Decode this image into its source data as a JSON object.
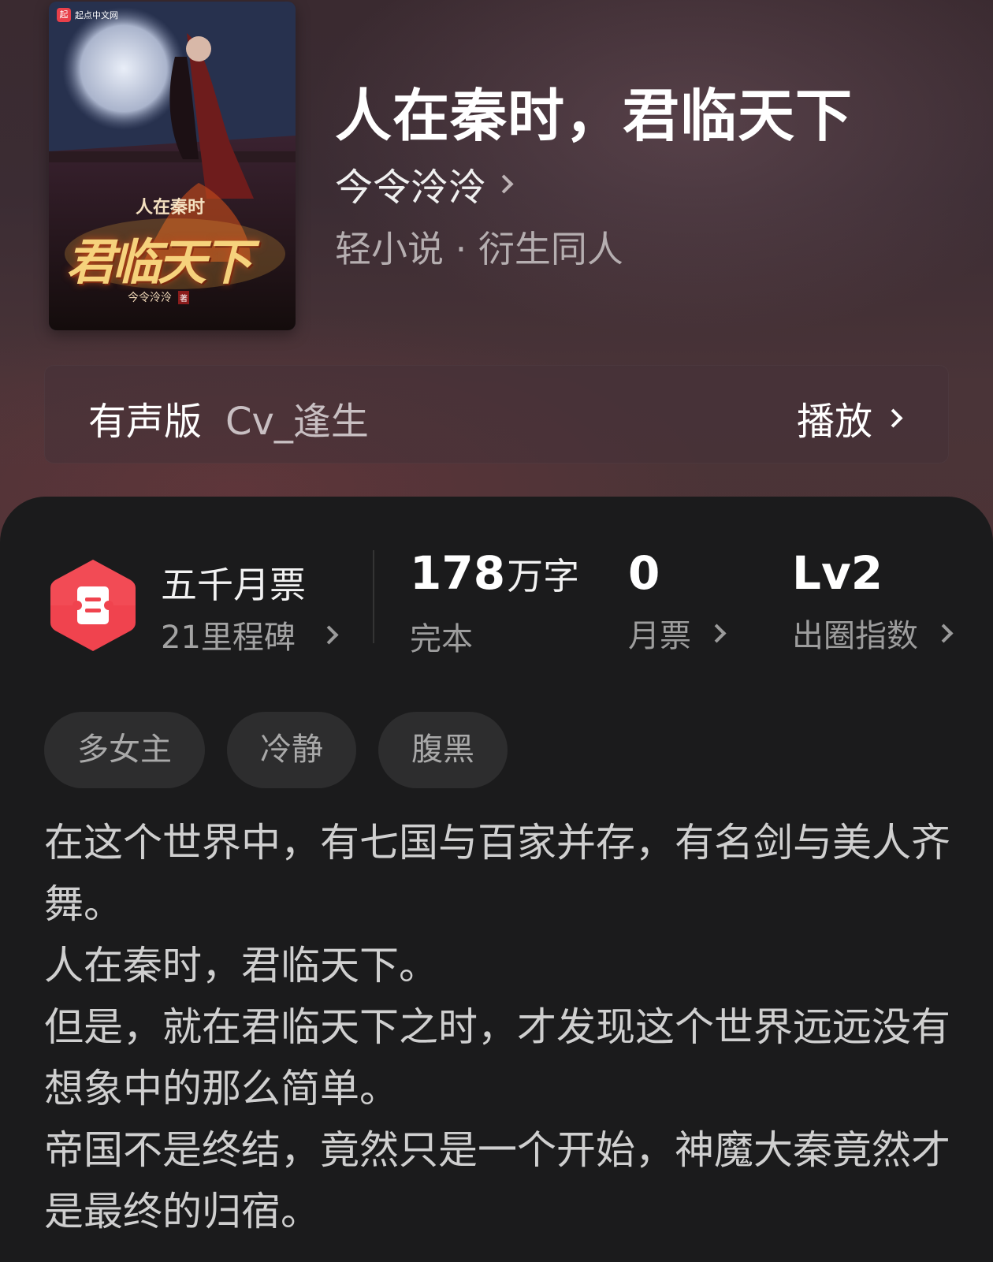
{
  "book": {
    "title": "人在秦时，君临天下",
    "author": "今令泠泠",
    "genre": "轻小说 · 衍生同人",
    "cover": {
      "publisher": "起点中文网",
      "title_small": "人在秦时",
      "title_large": "君临天下",
      "author": "今令泠泠",
      "author_suffix": "著"
    }
  },
  "audio": {
    "label": "有声版",
    "narrator": "Cv_逢生",
    "play_label": "播放"
  },
  "award": {
    "title": "五千月票",
    "subtitle": "21里程碑"
  },
  "stats": {
    "words_value": "178",
    "words_unit": "万字",
    "words_label": "完本",
    "tickets_value": "0",
    "tickets_label": "月票",
    "index_value": "Lv2",
    "index_label": "出圈指数"
  },
  "tags": [
    "多女主",
    "冷静",
    "腹黑"
  ],
  "synopsis": [
    "在这个世界中，有七国与百家并存，有名剑与美人齐舞。",
    "人在秦时，君临天下。",
    "但是，就在君临天下之时，才发现这个世界远远没有想象中的那么简单。",
    "帝国不是终结，竟然只是一个开始，神魔大秦竟然才是最终的归宿。"
  ],
  "colors": {
    "accent_red": "#f0434e",
    "sheet_bg": "#1b1b1c",
    "tag_bg": "#2d2d2e"
  }
}
